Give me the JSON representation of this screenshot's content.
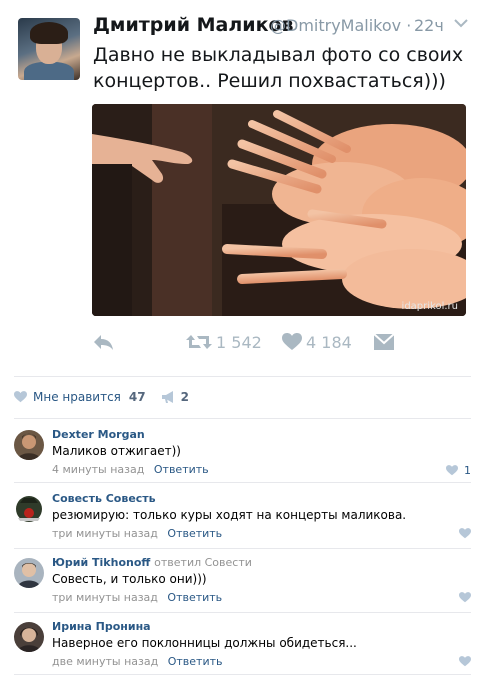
{
  "tweet": {
    "name": "Дмитрий Маликов",
    "handle": "@DmitryMalikov",
    "separator": "·",
    "time": "22ч",
    "text": "Давно не выкладывал фото со своих концертов.. Решил похвастаться)))",
    "photo_watermark": "idaprikol.ru",
    "retweets": "1 542",
    "likes": "4 184",
    "icons": [
      "reply-icon",
      "retweet-icon",
      "heart-icon",
      "message-icon",
      "chevron-down-icon"
    ]
  },
  "vk_bar": {
    "like_label": "Мне нравится",
    "like_count": "47",
    "share_count": "2"
  },
  "comments": [
    {
      "author": "Dexter Morgan",
      "replied": "",
      "text": "Маликов отжигает))",
      "time": "4 минуты назад",
      "reply_label": "Ответить",
      "likes": "1"
    },
    {
      "author": "Совесть Совесть",
      "replied": "",
      "text": "резюмирую: только куры ходят на концерты маликова.",
      "time": "три минуты назад",
      "reply_label": "Ответить",
      "likes": ""
    },
    {
      "author": "Юрий Tikhonoff",
      "replied": "ответил Совести",
      "text": "Совесть, и только они)))",
      "time": "три минуты назад",
      "reply_label": "Ответить",
      "likes": ""
    },
    {
      "author": "Ирина Пронина",
      "replied": "",
      "text": "Наверное его поклонницы должны обидеться...",
      "time": "две минуты назад",
      "reply_label": "Ответить",
      "likes": ""
    }
  ],
  "colors": {
    "twitter_gray": "#aab8c2",
    "vk_blue": "#2a5885",
    "meta_gray": "#939393"
  }
}
